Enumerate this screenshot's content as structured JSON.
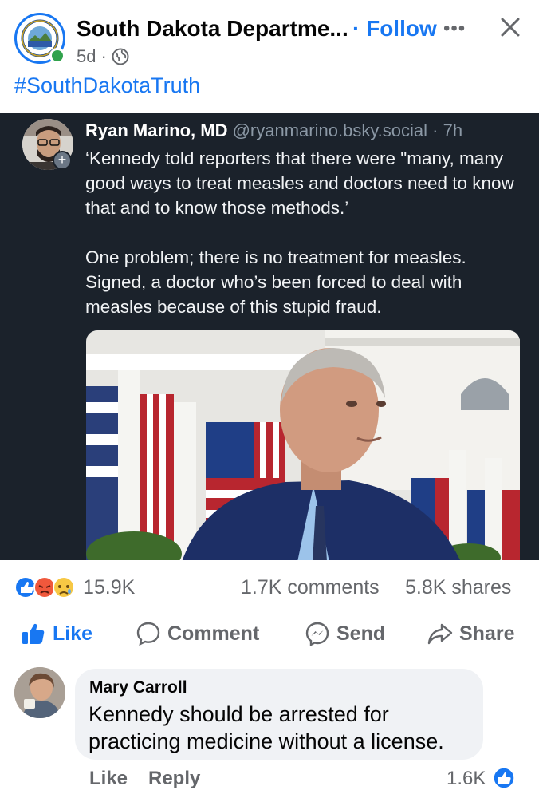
{
  "header": {
    "page_name": "South Dakota Departme...",
    "follow_label": "· Follow",
    "time": "5d",
    "separator": "·",
    "hashtag": "#SouthDakotaTruth"
  },
  "embed": {
    "author_name": "Ryan Marino, MD",
    "author_handle": "@ryanmarino.bsky.social · 7h",
    "paragraphs": [
      "‘Kennedy told reporters that there were \"many, many good ways to treat measles and doctors need to know that and to know those methods.’",
      "One problem; there is no treatment for measles. Signed, a doctor who’s been forced to deal with measles because of this stupid fraud."
    ]
  },
  "stats": {
    "reaction_count": "15.9K",
    "comments": "1.7K comments",
    "shares": "5.8K shares"
  },
  "actions": {
    "like": "Like",
    "comment": "Comment",
    "send": "Send",
    "share": "Share"
  },
  "comment": {
    "name": "Mary Carroll",
    "text": "Kennedy should be arrested for practicing medicine without a license.",
    "like": "Like",
    "reply": "Reply",
    "reaction_count": "1.6K"
  },
  "colors": {
    "accent": "#1877f2",
    "embed_bg": "#1b222b",
    "muted": "#65676b"
  }
}
